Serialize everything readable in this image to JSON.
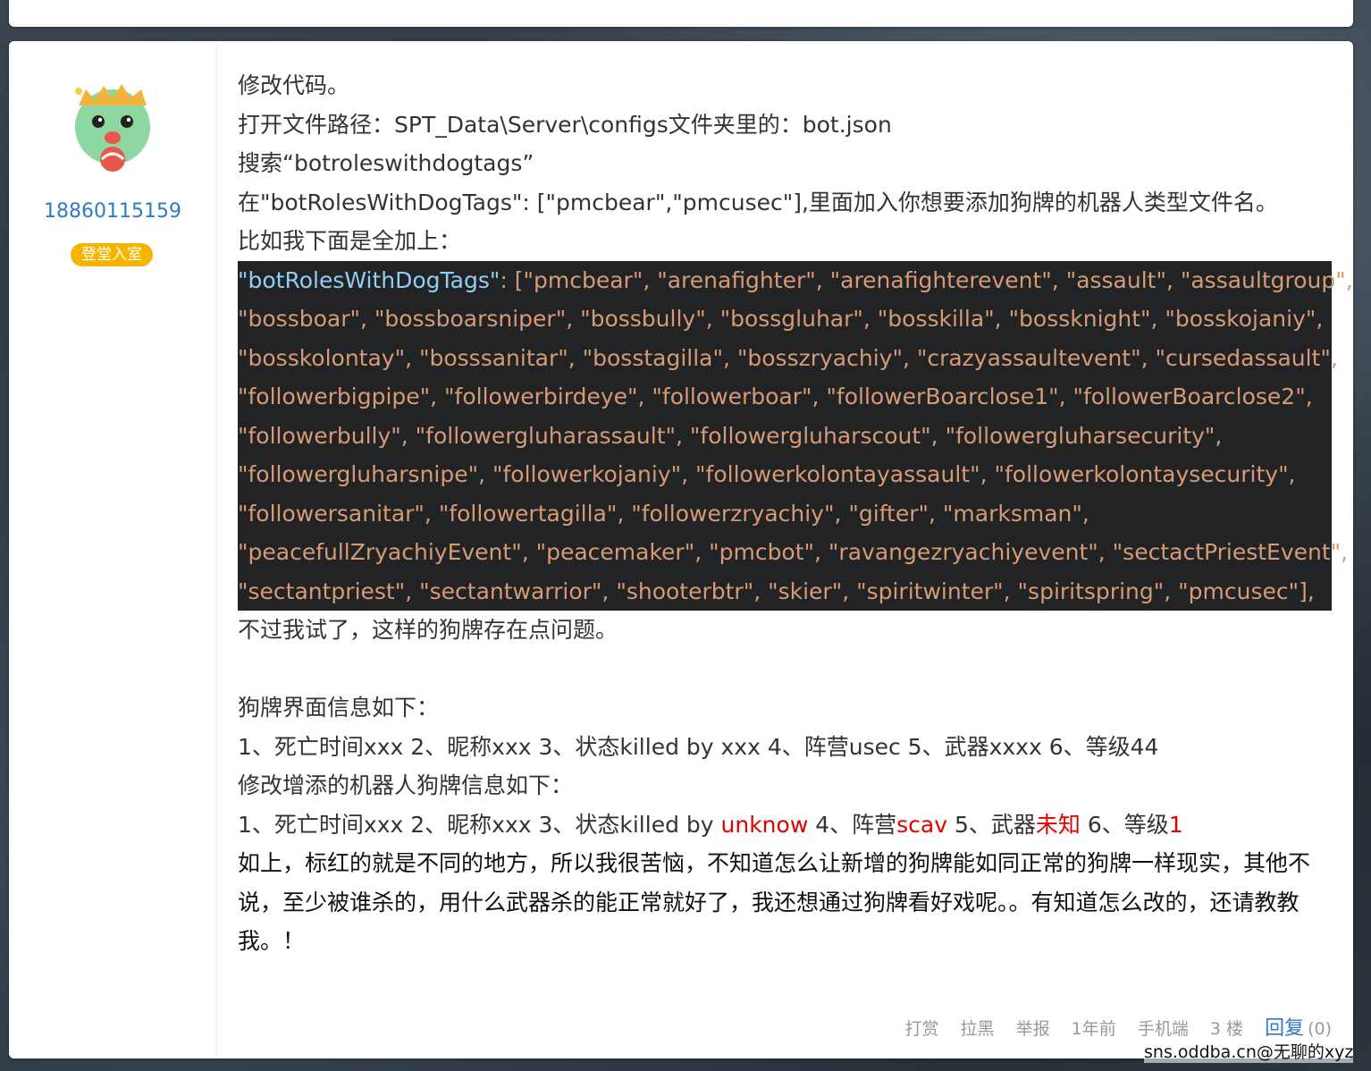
{
  "user": {
    "name": "18860115159",
    "badge": "登堂入室"
  },
  "post": {
    "line1": "修改代码。",
    "line2": "打开文件路径：SPT_Data\\Server\\configs文件夹里的：bot.json",
    "line3": "搜索“botroleswithdogtags”",
    "line4": "在\"botRolesWithDogTags\": [\"pmcbear\",\"pmcusec\"],里面加入你想要添加狗牌的机器人类型文件名。",
    "line5": "比如我下面是全加上：",
    "code_key": "\"botRolesWithDogTags\"",
    "code_lines": [
      ": [\"pmcbear\", \"arenafighter\", \"arenafighterevent\", \"assault\", \"assaultgroup\",",
      "\"bossboar\", \"bossboarsniper\", \"bossbully\", \"bossgluhar\", \"bosskilla\", \"bossknight\", \"bosskojaniy\",",
      "\"bosskolontay\", \"bosssanitar\", \"bosstagilla\", \"bosszryachiy\", \"crazyassaultevent\", \"cursedassault\",",
      "\"followerbigpipe\", \"followerbirdeye\", \"followerboar\", \"followerBoarclose1\", \"followerBoarclose2\",",
      "\"followerbully\", \"followergluharassault\", \"followergluharscout\", \"followergluharsecurity\",",
      "\"followergluharsnipe\", \"followerkojaniy\", \"followerkolontayassault\", \"followerkolontaysecurity\",",
      "\"followersanitar\", \"followertagilla\", \"followerzryachiy\", \"gifter\", \"marksman\",",
      "\"peacefullZryachiyEvent\", \"peacemaker\", \"pmcbot\", \"ravangezryachiyevent\", \"sectactPriestEvent\",",
      "\"sectantpriest\", \"sectantwarrior\", \"shooterbtr\", \"skier\", \"spiritwinter\", \"spiritspring\", \"pmcusec\"],"
    ],
    "line6": "不过我试了，这样的狗牌存在点问题。",
    "line7": "狗牌界面信息如下：",
    "line8": "1、死亡时间xxx 2、昵称xxx 3、状态killed by xxx 4、阵营usec 5、武器xxxx 6、等级44",
    "line9": "修改增添的机器人狗牌信息如下：",
    "line10": {
      "a": "1、死亡时间xxx 2、昵称xxx 3、状态killed by ",
      "b": "unknow",
      "c": " 4、阵营",
      "d": "scav",
      "e": " 5、武器",
      "f": "未知",
      "g": " 6、等级",
      "h": "1"
    },
    "line11": "如上，标红的就是不同的地方，所以我很苦恼，不知道怎么让新增的狗牌能如同正常的狗牌一样现实，其他不说，至少被谁杀的，用什么武器杀的能正常就好了，我还想通过狗牌看好戏呢。。有知道怎么改的，还请教教我。！"
  },
  "footer": {
    "reward": "打赏",
    "block": "拉黑",
    "report": "举报",
    "time": "1年前",
    "device": "手机端",
    "floor": "3 楼",
    "reply": "回复",
    "reply_count": "(0)"
  },
  "watermark": "sns.oddba.cn@无聊的xyz",
  "colors": {
    "link": "#2f79c7",
    "badge": "#f5b400",
    "highlight_red": "#e00000",
    "code_bg": "#222324",
    "code_string": "#d69a76",
    "code_key": "#8ed0f5"
  }
}
